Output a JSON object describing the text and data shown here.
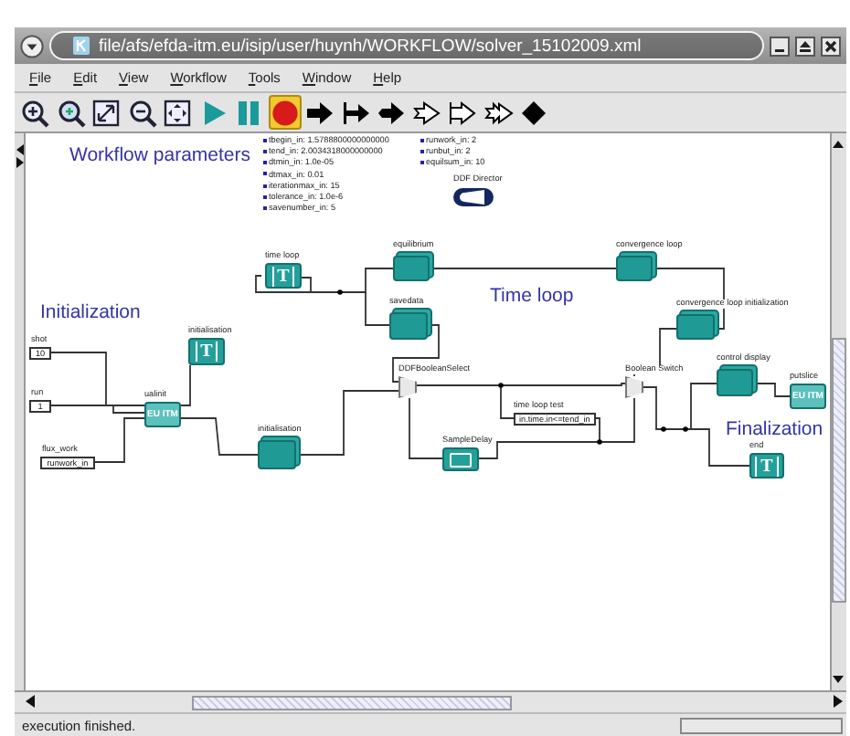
{
  "window": {
    "title": "file/afs/efda-itm.eu/isip/user/huynh/WORKFLOW/solver_15102009.xml"
  },
  "menu": [
    {
      "label": "File"
    },
    {
      "label": "Edit"
    },
    {
      "label": "View"
    },
    {
      "label": "Workflow"
    },
    {
      "label": "Tools"
    },
    {
      "label": "Window"
    },
    {
      "label": "Help"
    }
  ],
  "toolbar": [
    {
      "kind": "zoom-in",
      "active": false
    },
    {
      "kind": "zoom-reset",
      "active": false
    },
    {
      "kind": "fit",
      "active": false
    },
    {
      "kind": "zoom-out",
      "active": false
    },
    {
      "kind": "full",
      "active": false
    },
    {
      "kind": "run",
      "active": false
    },
    {
      "kind": "pause",
      "active": false
    },
    {
      "kind": "stop",
      "active": true
    },
    {
      "kind": "arrow",
      "active": false
    },
    {
      "kind": "bar-arrow",
      "active": false
    },
    {
      "kind": "short-arrow",
      "active": false
    },
    {
      "kind": "outline-arrow",
      "active": false
    },
    {
      "kind": "outline-bar-arrow",
      "active": false
    },
    {
      "kind": "outline-double-arrow",
      "active": false
    },
    {
      "kind": "diamond",
      "active": false
    }
  ],
  "canvas": {
    "headings": [
      {
        "text": "Workflow parameters"
      },
      {
        "text": "Initialization"
      },
      {
        "text": "Time loop"
      },
      {
        "text": "Finalization"
      }
    ],
    "parameters": [
      "tbegin_in: 1.5788800000000000",
      "tend_in: 2.0034318000000000",
      "dtmin_in: 1.0e-05",
      "dtmax_in: 0.01",
      "iterationmax_in: 15",
      "tolerance_in: 1.0e-6",
      "savenumber_in: 5"
    ],
    "parameters_2": [
      "runwork_in: 2",
      "runbut_in: 2",
      "equilsum_in: 10"
    ],
    "director": {
      "label": "DDF Director"
    },
    "actors": [
      {
        "kind": "timer",
        "label": "time loop",
        "glyph": "T"
      },
      {
        "kind": "composite",
        "label": "equilibrium"
      },
      {
        "kind": "composite",
        "label": "savedata"
      },
      {
        "kind": "composite",
        "label": "convergence loop"
      },
      {
        "kind": "composite",
        "label": "convergence loop initialization"
      },
      {
        "kind": "select",
        "label": "DDFBooleanSelect"
      },
      {
        "kind": "select",
        "label": "Boolean Switch"
      },
      {
        "kind": "composite",
        "label": "control display"
      },
      {
        "kind": "itm",
        "label": "putslice",
        "value": "EU ITM"
      },
      {
        "kind": "expression",
        "label": "time loop test",
        "value": "in.time.in<=tend_in"
      },
      {
        "kind": "delay",
        "label": "SampleDelay"
      },
      {
        "kind": "timer",
        "label": "end",
        "glyph": "T"
      },
      {
        "kind": "itm",
        "label": "ualinit",
        "value": "EU ITM"
      },
      {
        "kind": "timer",
        "label": "initialisation",
        "glyph": "T"
      },
      {
        "kind": "composite",
        "label": "initialisation"
      },
      {
        "kind": "const",
        "label": "shot",
        "value": "10"
      },
      {
        "kind": "const",
        "label": "run",
        "value": "1"
      },
      {
        "kind": "const",
        "label": "flux_work",
        "value": "runwork_in"
      }
    ]
  },
  "status_bar": {
    "message": "execution finished.",
    "progress": {
      "level": 0
    }
  }
}
